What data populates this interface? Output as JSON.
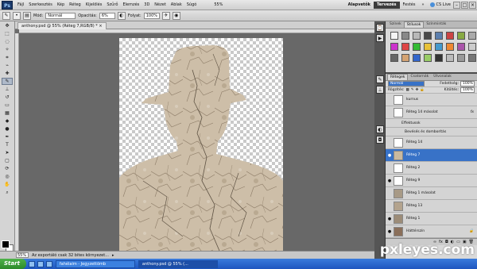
{
  "app": {
    "logo": "Ps",
    "accent": "#3872c7"
  },
  "menu": [
    "Fájl",
    "Szerkesztés",
    "Kép",
    "Réteg",
    "Kijelölés",
    "Szűrő",
    "Elemzés",
    "3D",
    "Nézet",
    "Ablak",
    "Súgó"
  ],
  "workspaces": {
    "alapvetok": "Alapvetők",
    "tervezes": "Tervezés",
    "festes": "Festés"
  },
  "cslive": "CS Live",
  "zoom_top": "55%",
  "options": {
    "mode_label": "Mód:",
    "mode_value": "Normál",
    "opacity_label": "Opacitás:",
    "opacity_value": "6%",
    "flow_label": "Folyat:",
    "flow_value": "100%"
  },
  "document": {
    "tab_title": "anthony.psd @ 55% (Réteg 7,RGB/8) *"
  },
  "status": {
    "zoom": "55%",
    "info": "Az exportáló csak 32 bites környezet..."
  },
  "panels": {
    "top_tabs": [
      "Színek",
      "Stílusok",
      "Színminták"
    ],
    "top_active": "Stílusok",
    "layer_tabs": [
      "Rétegek",
      "Csatornák",
      "Útvonalak"
    ],
    "layer_active": "Rétegek",
    "blend_mode": "Normál",
    "opacity_label": "Fedettség:",
    "opacity_value": "100%",
    "lock_label": "Rögzítés:",
    "fill_label": "Kitöltés:",
    "fill_value": "100%",
    "layers": [
      {
        "name": "kurnus",
        "type": "plain"
      },
      {
        "name": "Réteg 14 másolat",
        "type": "plain",
        "fx": "fx"
      },
      {
        "name": "Effektusok",
        "type": "sub"
      },
      {
        "name": "Bevésés és domborítás",
        "type": "sub2"
      },
      {
        "name": "Réteg 14",
        "type": "plain"
      },
      {
        "name": "Réteg 7",
        "type": "selected"
      },
      {
        "name": "Réteg 2",
        "type": "plain"
      },
      {
        "name": "Réteg 9",
        "type": "plain"
      },
      {
        "name": "Réteg 1 másolat",
        "type": "plain"
      },
      {
        "name": "Réteg 13",
        "type": "plain"
      },
      {
        "name": "Réteg 1",
        "type": "plain"
      },
      {
        "name": "Háttérszín",
        "type": "plain"
      }
    ]
  },
  "taskbar": {
    "start": "Start",
    "tasks": [
      "fahélaim - Jegyzettömb",
      "anthony.psd @ 55% (..."
    ]
  },
  "watermark": "pxleyes.com"
}
